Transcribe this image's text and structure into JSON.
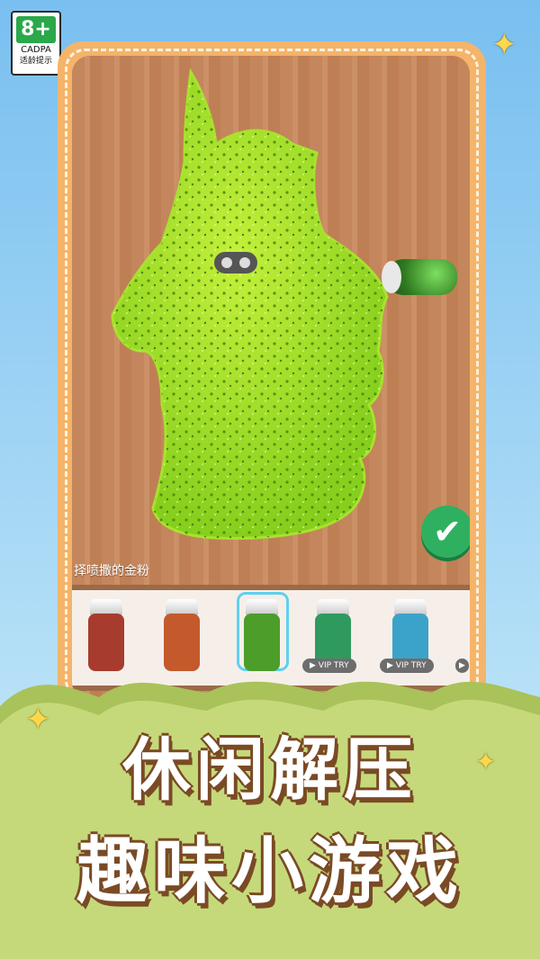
{
  "rating": {
    "age": "8+",
    "org": "CADPA",
    "label": "适龄提示"
  },
  "game": {
    "hint": "择喷撒的金粉"
  },
  "glitters": [
    {
      "color": "#a73b2e",
      "selected": false,
      "vip": false
    },
    {
      "color": "#c45a2c",
      "selected": false,
      "vip": false
    },
    {
      "color": "#4c9d2a",
      "selected": true,
      "vip": false
    },
    {
      "color": "#2f9a5e",
      "selected": false,
      "vip": true
    },
    {
      "color": "#3ba3c9",
      "selected": false,
      "vip": true
    }
  ],
  "vip_label": "VIP TRY",
  "banner": {
    "line1": "休闲解压",
    "line2": "趣味小游戏"
  }
}
